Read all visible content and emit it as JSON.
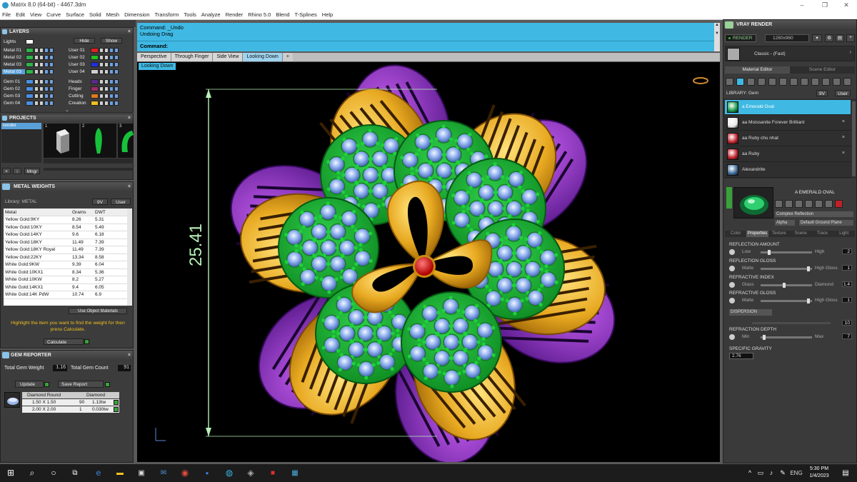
{
  "window": {
    "title": "Matrix 8.0 (64-bit) - 4467.3dm",
    "min": "–",
    "max": "❐",
    "close": "✕"
  },
  "menu": [
    "File",
    "Edit",
    "View",
    "Curve",
    "Surface",
    "Solid",
    "Mesh",
    "Dimension",
    "Transform",
    "Tools",
    "Analyze",
    "Render",
    "Rhino 5.0",
    "Blend",
    "T-Splines",
    "Help"
  ],
  "layers": {
    "title": "LAYERS",
    "lights": "Lights",
    "hide": "Hide",
    "show": "Show",
    "left": [
      {
        "name": "Metal 01",
        "color": "#2db34a"
      },
      {
        "name": "Metal 02",
        "color": "#2db34a"
      },
      {
        "name": "Metal 03",
        "color": "#2db34a"
      },
      {
        "name": "Metal 03",
        "color": "#2db34a",
        "selected": true
      },
      {
        "name": "Gem 01",
        "color": "#4a90e2"
      },
      {
        "name": "Gem 02",
        "color": "#4a90e2"
      },
      {
        "name": "Gem 03",
        "color": "#4a90e2"
      },
      {
        "name": "Gem 04",
        "color": "#4a90e2"
      }
    ],
    "right": [
      {
        "name": "User 01",
        "color": "#e02020"
      },
      {
        "name": "User 02",
        "color": "#20c020"
      },
      {
        "name": "User 03",
        "color": "#2030e0"
      },
      {
        "name": "User 04",
        "color": "#d0d0d0"
      },
      {
        "name": "Heads",
        "color": "#5a2a8a"
      },
      {
        "name": "Finger",
        "color": "#a02a6a"
      },
      {
        "name": "Cutting",
        "color": "#e07a20"
      },
      {
        "name": "Creation",
        "color": "#f0c020"
      }
    ]
  },
  "projects": {
    "title": "PROJECTS",
    "item": "render",
    "thumbs": [
      "1",
      "2",
      "3"
    ],
    "add": "+",
    "up": "↑",
    "mngr": "Mngr"
  },
  "metal_weights": {
    "title": "METAL WEIGHTS",
    "library_label": "Library: METAL",
    "lib_btn1": "9V",
    "lib_btn2": "User",
    "columns": [
      "Metal",
      "Grams",
      "DWT"
    ],
    "rows": [
      [
        "Yellow Gold:9KY",
        "8.26",
        "5.31"
      ],
      [
        "Yellow Gold:10KY",
        "8.54",
        "5.49"
      ],
      [
        "Yellow Gold:14KY",
        "9.6",
        "6.18"
      ],
      [
        "Yellow Gold:18KY",
        "11.49",
        "7.39"
      ],
      [
        "Yellow Gold:18KY Royal",
        "11.49",
        "7.39"
      ],
      [
        "Yellow Gold:22KY",
        "13.34",
        "8.58"
      ],
      [
        "White Gold:9KW",
        "9.39",
        "6.04"
      ],
      [
        "White Gold:10KX1",
        "8.34",
        "5.36"
      ],
      [
        "White Gold:10KW",
        "8.2",
        "5.27"
      ],
      [
        "White Gold:14KX1",
        "9.4",
        "6.05"
      ],
      [
        "White Gold:14K PdW",
        "10.74",
        "6.9"
      ]
    ],
    "use_object": "Use Object Materials",
    "hint": "Highlight the item you want to find the weight for then press Calculate.",
    "calculate": "Calculate"
  },
  "gem_reporter": {
    "title": "GEM REPORTER",
    "weight_label": "Total Gem Weight",
    "weight_value": "1.16",
    "count_label": "Total Gem Count",
    "count_value": "91",
    "update": "Update",
    "save": "Save Report",
    "headers": [
      "Diamond Round",
      "Diamond"
    ],
    "rows": [
      [
        "1.50 X 1.50",
        "90",
        "1.13tw"
      ],
      [
        "2.00 X 2.00",
        "1",
        "0.030tw"
      ]
    ]
  },
  "command": {
    "line1": "Command: _Undo",
    "line2": "Undoing Drag",
    "prompt": "Command:"
  },
  "view_tabs": [
    "Perspective",
    "Through Finger",
    "Side View",
    "Looking Down"
  ],
  "active_tab": "Looking Down",
  "viewport_label": "Looking Down",
  "dimension": "25.41",
  "vray": {
    "title": "VRAY RENDER",
    "render_btn": "RENDER",
    "resolution": "1280x960",
    "preset": "Classic - (Fast)",
    "tabs": [
      "Material Editor",
      "Scene Editor"
    ],
    "library": "LIBRARY: Gem",
    "lib_btn1": "9V",
    "lib_btn2": "User",
    "materials": [
      {
        "name": "a Emerald Oval",
        "color": "#1a9a4a",
        "selected": true
      },
      {
        "name": "aa Moissanite Forever Brilliant",
        "color": "#e8e8e8"
      },
      {
        "name": "aa Ruby chu nhat",
        "color": "#c0202a"
      },
      {
        "name": "aa Ruby",
        "color": "#c0202a"
      },
      {
        "name": "Alexandrite",
        "color": "#3a6a9a"
      }
    ],
    "preview_name": "A EMERALD OVAL",
    "complex": "Complex Reflection",
    "alpha": "Alpha",
    "ground": "Default Ground Plane",
    "prop_tabs": [
      "Color",
      "Properties",
      "Texture",
      "Scene",
      "Trace",
      "Light"
    ],
    "reflection_amount": {
      "label": "REFLECTION AMOUNT",
      "low": "Low",
      "high": "High",
      "value": "2"
    },
    "reflection_gloss": {
      "label": "REFLECTION GLOSS",
      "low": "Matte",
      "high": "High Gloss",
      "value": "1"
    },
    "refractive_index": {
      "label": "REFRACTIVE INDEX",
      "low": "Glass",
      "high": "Diamond",
      "value": "1.4"
    },
    "refractive_gloss": {
      "label": "REFRACTIVE GLOSS",
      "low": "Matte",
      "high": "High Gloss",
      "value": "1"
    },
    "dispersion": "DISPERSION",
    "dispersion_value": "10",
    "refraction_depth": {
      "label": "REFRACTION DEPTH",
      "low": "Min",
      "high": "Max",
      "value": "7"
    },
    "specific_gravity": {
      "label": "SPECIFIC GRAVITY",
      "value": "2.76"
    }
  },
  "taskbar": {
    "time": "5:30 PM",
    "date": "1/4/2023",
    "lang": "ENG"
  }
}
